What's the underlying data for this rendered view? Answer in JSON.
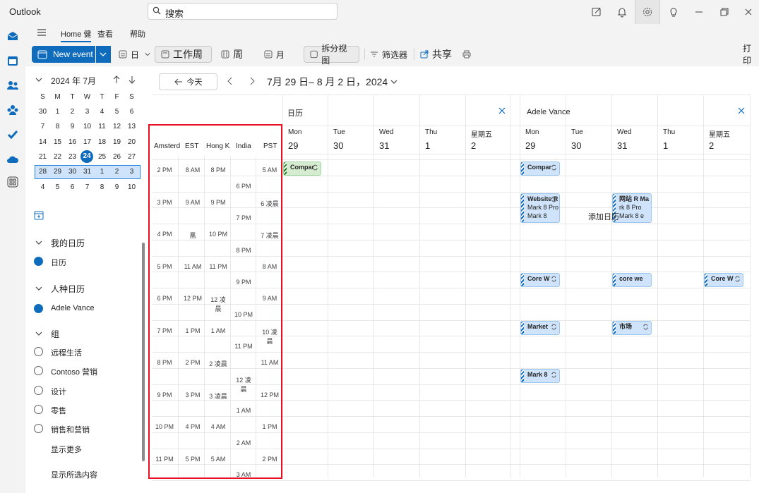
{
  "app": {
    "title": "Outlook"
  },
  "search": {
    "placeholder": "搜索"
  },
  "ribbon_tabs": {
    "home": "Home 健",
    "view": "查看",
    "help": "帮助"
  },
  "ribbon": {
    "new_event": "New event",
    "day": "日",
    "work_week": "工作周",
    "week": "周",
    "month": "月",
    "split_view": "拆分视图",
    "filter": "筛选器",
    "share": "共享",
    "print": "打印"
  },
  "mini_calendar": {
    "month_label": "2024 年 7月",
    "weekday_headers": [
      "S",
      "M",
      "T",
      "W",
      "T",
      "F",
      "S"
    ],
    "weeks": [
      [
        "30",
        "1",
        "2",
        "3",
        "4",
        "5",
        "6"
      ],
      [
        "7",
        "8",
        "9",
        "10",
        "11",
        "12",
        "13"
      ],
      [
        "14",
        "15",
        "16",
        "17",
        "18",
        "19",
        "20"
      ],
      [
        "21",
        "22",
        "23",
        "24",
        "25",
        "26",
        "27"
      ],
      [
        "28",
        "29",
        "30",
        "31",
        "1",
        "2",
        "3"
      ],
      [
        "4",
        "5",
        "6",
        "7",
        "8",
        "9",
        "10"
      ]
    ],
    "today": "24"
  },
  "calendars": {
    "my_calendars": "我的日历",
    "calendar": "日历",
    "people_calendars": "人种日历",
    "adele": "Adele Vance",
    "groups": "组",
    "group_items": [
      "远程生活",
      "Contoso 营销",
      "设计",
      "零售",
      "销售和营销"
    ],
    "show_more": "显示更多",
    "show_selected": "显示所选内容"
  },
  "nav": {
    "today": "今天",
    "date_range": "7月 29 日– 8 月 2 日，2024"
  },
  "timezones": {
    "headers": [
      "Amsterd",
      "EST",
      "Hong K",
      "India",
      "PST"
    ],
    "amsterdam": [
      "2 PM",
      "3 PM",
      "4 PM",
      "5 PM",
      "6 PM",
      "7 PM",
      "8 PM",
      "9 PM",
      "10 PM",
      "11 PM"
    ],
    "est": [
      "8 AM",
      "9 AM",
      "凰",
      "11 AM",
      "12 PM",
      "1 PM",
      "2 PM",
      "3 PM",
      "4 PM",
      "5 PM"
    ],
    "hongkong": [
      "8 PM",
      "9 PM",
      "10 PM",
      "11 PM",
      "12 凌晨",
      "1 AM",
      "2 凌晨",
      "3 凌晨",
      "4 AM",
      "5 AM"
    ],
    "india": [
      "6 PM",
      "7 PM",
      "8 PM",
      "9 PM",
      "10 PM",
      "11 PM",
      "12 凌晨",
      "1 AM",
      "2 AM",
      "3 AM"
    ],
    "pst": [
      "5 AM",
      "6 凌晨",
      "7 凌晨",
      "8 AM",
      "9 AM",
      "10 凌晨",
      "11 AM",
      "12 PM",
      "1 PM",
      "2 PM"
    ]
  },
  "panes": {
    "left": {
      "title": "日历",
      "days": [
        {
          "name": "Mon",
          "num": "29"
        },
        {
          "name": "Tue",
          "num": "30"
        },
        {
          "name": "Wed",
          "num": "31"
        },
        {
          "name": "Thu",
          "num": "1"
        },
        {
          "name": "星期五",
          "num": "2"
        }
      ]
    },
    "right": {
      "title": "Adele Vance",
      "days": [
        {
          "name": "Mon",
          "num": "29"
        },
        {
          "name": "Tue",
          "num": "30"
        },
        {
          "name": "Wed",
          "num": "31"
        },
        {
          "name": "Thu",
          "num": "1"
        },
        {
          "name": "星期五",
          "num": "2"
        }
      ]
    }
  },
  "events": {
    "company_left": "Compar",
    "company_right": "Compar",
    "website_title": "Website R",
    "website_line2": "Mark 8 Pro",
    "website_line3": "Mark 8",
    "wed_site_title": "网站 R Ma",
    "wed_site_line2": "rk 8 Pro",
    "wed_site_line3": "Mark 8 e",
    "add_calendar": "添加日历",
    "core_mon": "Core W",
    "core_wed": "core we",
    "core_fri": "Core W",
    "market_mon": "Market",
    "market_wed": "市场",
    "mark8_mon": "Mark 8"
  }
}
